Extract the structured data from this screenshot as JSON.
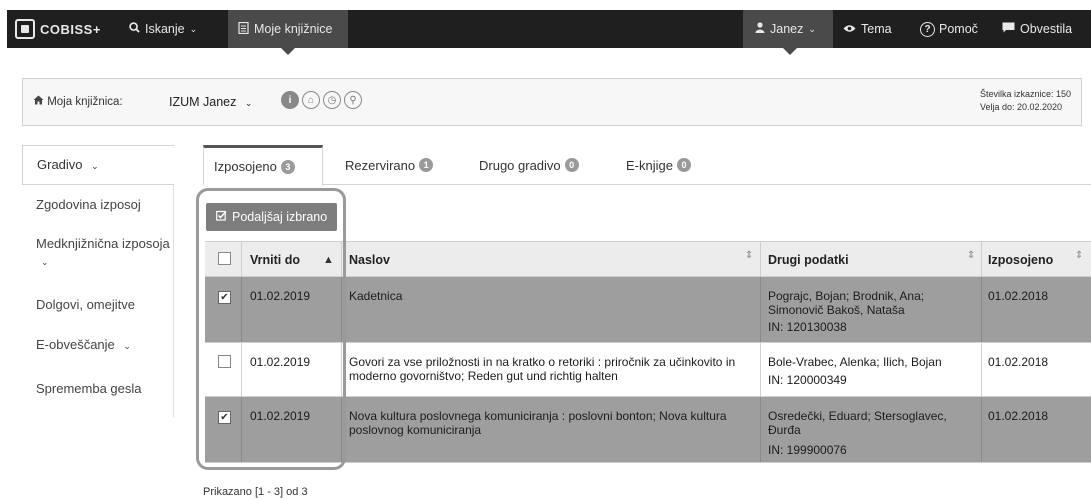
{
  "topbar": {
    "logo": "COBISS+",
    "search": "Iskanje",
    "my_libraries": "Moje knjižnice",
    "user": "Janez",
    "theme": "Tema",
    "help": "Pomoč",
    "notices": "Obvestila"
  },
  "library": {
    "label": "Moja knjižnica:",
    "name": "IZUM Janez",
    "card_number": "Številka izkaznice: 150",
    "valid_until": "Velja do: 20.02.2020"
  },
  "sidebar": {
    "items": [
      {
        "label": "Gradivo"
      },
      {
        "label": "Zgodovina izposoj"
      },
      {
        "label": "Medknjižnična izposoja"
      },
      {
        "label": "Dolgovi, omejitve"
      },
      {
        "label": "E-obveščanje"
      },
      {
        "label": "Sprememba gesla"
      }
    ]
  },
  "tabs": [
    {
      "label": "Izposojeno",
      "count": "3"
    },
    {
      "label": "Rezervirano",
      "count": "1"
    },
    {
      "label": "Drugo gradivo",
      "count": "0"
    },
    {
      "label": "E-knjige",
      "count": "0"
    }
  ],
  "actions": {
    "extend_selected": "Podaljšaj izbrano"
  },
  "table": {
    "headers": {
      "due": "Vrniti do",
      "title": "Naslov",
      "other": "Drugi podatki",
      "loaned": "Izposojeno"
    },
    "rows": [
      {
        "checked": true,
        "due": "01.02.2019",
        "title": "Kadetnica",
        "other_lines": [
          "Pograjc, Bojan; Brodnik, Ana;",
          "Simonovič Bakoš, Nataša"
        ],
        "id": "IN: 120130038",
        "loaned": "01.02.2018"
      },
      {
        "checked": false,
        "due": "01.02.2019",
        "title": "Govori za vse priložnosti in na kratko o retoriki : priročnik za učinkovito in moderno govorništvo; Reden gut und richtig halten",
        "other_lines": [
          "Bole-Vrabec, Alenka; Ilich, Bojan"
        ],
        "id": "IN: 120000349",
        "loaned": "01.02.2018"
      },
      {
        "checked": true,
        "due": "01.02.2019",
        "title": "Nova kultura poslovnega komuniciranja : poslovni bonton; Nova kultura poslovnog komuniciranja",
        "other_lines": [
          "Osredečki, Eduard; Stersoglavec,",
          "Đurđa"
        ],
        "id": "IN: 199900076",
        "loaned": "01.02.2018"
      }
    ]
  },
  "footer": {
    "shown": "Prikazano [1 - 3] od 3"
  }
}
